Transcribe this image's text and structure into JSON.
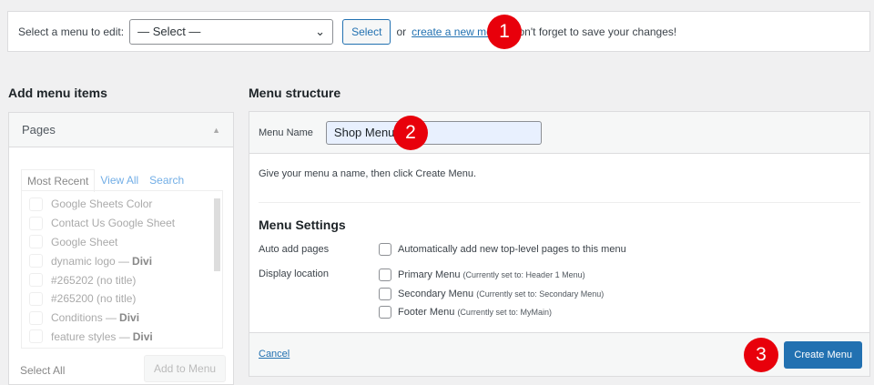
{
  "top": {
    "label": "Select a menu to edit:",
    "select_value": "— Select —",
    "select_button": "Select",
    "or": "or",
    "create_link": "create a new menu",
    "reminder": ". Don't forget to save your changes!"
  },
  "badges": [
    "1",
    "2",
    "3"
  ],
  "left": {
    "heading": "Add menu items",
    "panel": "Pages",
    "tabs": [
      "Most Recent",
      "View All",
      "Search"
    ],
    "items": [
      {
        "t": "Google Sheets Color",
        "b": ""
      },
      {
        "t": "Contact Us Google Sheet",
        "b": ""
      },
      {
        "t": "Google Sheet",
        "b": ""
      },
      {
        "t": "dynamic logo — ",
        "b": "Divi"
      },
      {
        "t": "#265202 (no title)",
        "b": ""
      },
      {
        "t": "#265200 (no title)",
        "b": ""
      },
      {
        "t": "Conditions — ",
        "b": "Divi"
      },
      {
        "t": "feature styles — ",
        "b": "Divi"
      }
    ],
    "select_all": "Select All",
    "add_button": "Add to Menu"
  },
  "right": {
    "heading": "Menu structure",
    "name_label": "Menu Name",
    "name_value": "Shop Menu",
    "hint": "Give your menu a name, then click Create Menu.",
    "settings": "Menu Settings",
    "auto_label": "Auto add pages",
    "auto_text": "Automatically add new top-level pages to this menu",
    "display_label": "Display location",
    "locations": [
      {
        "name": "Primary Menu",
        "note": "(Currently set to: Header 1 Menu)"
      },
      {
        "name": "Secondary Menu",
        "note": "(Currently set to: Secondary Menu)"
      },
      {
        "name": "Footer Menu",
        "note": "(Currently set to: MyMain)"
      }
    ],
    "cancel": "Cancel",
    "create": "Create Menu"
  }
}
